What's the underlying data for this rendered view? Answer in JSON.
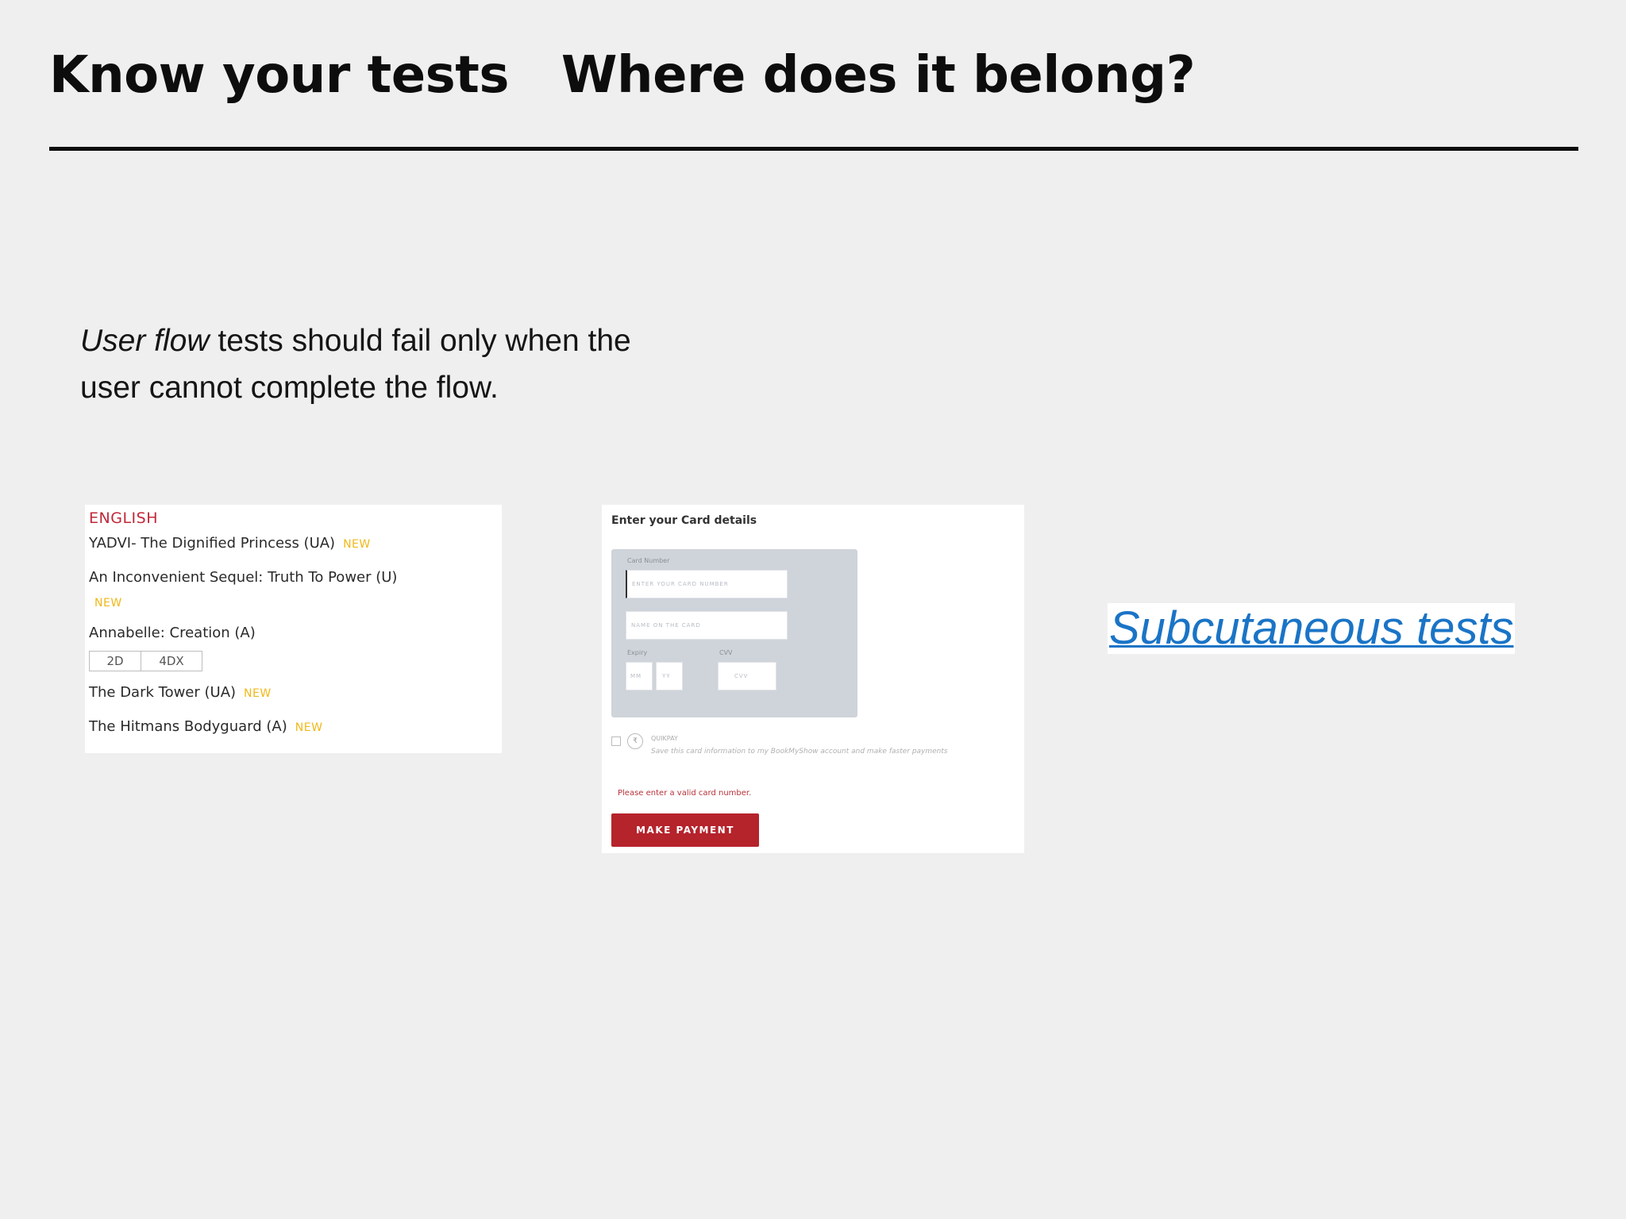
{
  "slide": {
    "title_left": "Know your tests",
    "title_right": "Where does it belong?",
    "body_emphasis": "User flow",
    "body_rest_line1": " tests should fail only when the",
    "body_line2": "user cannot complete the flow.",
    "link_text": "Subcutaneous tests"
  },
  "movie_list": {
    "language": "ENGLISH",
    "movies": [
      {
        "title": "YADVI- The Dignified Princess (UA)",
        "badge": "NEW"
      },
      {
        "title": "An Inconvenient Sequel: Truth To Power (U)",
        "badge": "NEW"
      },
      {
        "title": "Annabelle: Creation (A)",
        "formats": [
          "2D",
          "4DX"
        ]
      },
      {
        "title": "The Dark Tower (UA)",
        "badge": "NEW"
      },
      {
        "title": "The Hitmans Bodyguard (A)",
        "badge": "NEW"
      }
    ]
  },
  "payment": {
    "title": "Enter your Card details",
    "card_number_label": "Card Number",
    "card_number_placeholder": "ENTER YOUR CARD NUMBER",
    "name_placeholder": "NAME ON THE CARD",
    "expiry_label": "Expiry",
    "expiry_month_placeholder": "MM",
    "expiry_year_placeholder": "YY",
    "cvv_label": "CVV",
    "cvv_placeholder": "CVV",
    "save_brand": "QUIKPAY",
    "save_note": "Save this card information to my BookMyShow account and make faster payments",
    "error_text": "Please enter a valid card number.",
    "button_label": "MAKE PAYMENT"
  },
  "colors": {
    "background": "#efeff0",
    "link": "#1a74c6",
    "language_red": "#c0283a",
    "new_badge": "#f0b81a",
    "payment_button": "#b5232b"
  }
}
